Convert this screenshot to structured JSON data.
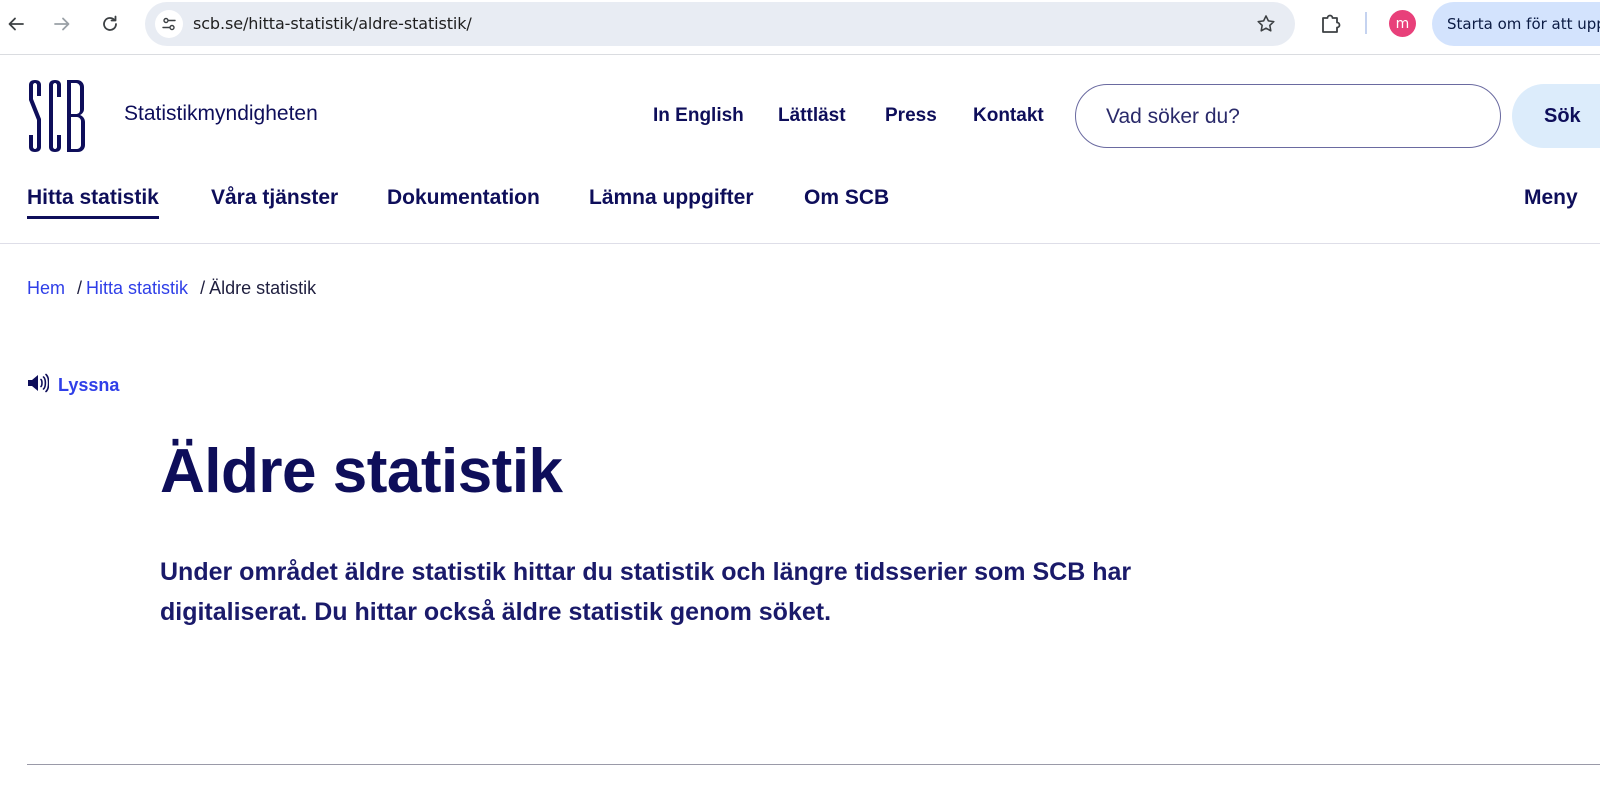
{
  "browser": {
    "url": "scb.se/hitta-statistik/aldre-statistik/",
    "profile_initial": "m",
    "restart_label": "Starta om för att uppdatera"
  },
  "header": {
    "org_name": "Statistikmyndigheten",
    "top_links": [
      "In English",
      "Lättläst",
      "Press",
      "Kontakt"
    ],
    "search_placeholder": "Vad söker du?",
    "search_button": "Sök"
  },
  "main_nav": {
    "items": [
      "Hitta statistik",
      "Våra tjänster",
      "Dokumentation",
      "Lämna uppgifter",
      "Om SCB"
    ],
    "active": "Hitta statistik",
    "menu_label": "Meny"
  },
  "breadcrumb": {
    "items": [
      "Hem",
      "Hitta statistik"
    ],
    "separator": "/",
    "current": "Äldre statistik"
  },
  "listen": {
    "label": "Lyssna"
  },
  "content": {
    "title": "Äldre statistik",
    "lead": "Under området äldre statistik hittar du statistik och längre tidsserier som SCB har digitaliserat. Du hittar också äldre statistik genom söket."
  },
  "colors": {
    "brand_navy": "#0e0e5a",
    "link_blue": "#2f3fe8",
    "search_button_bg": "#dcecfb"
  }
}
